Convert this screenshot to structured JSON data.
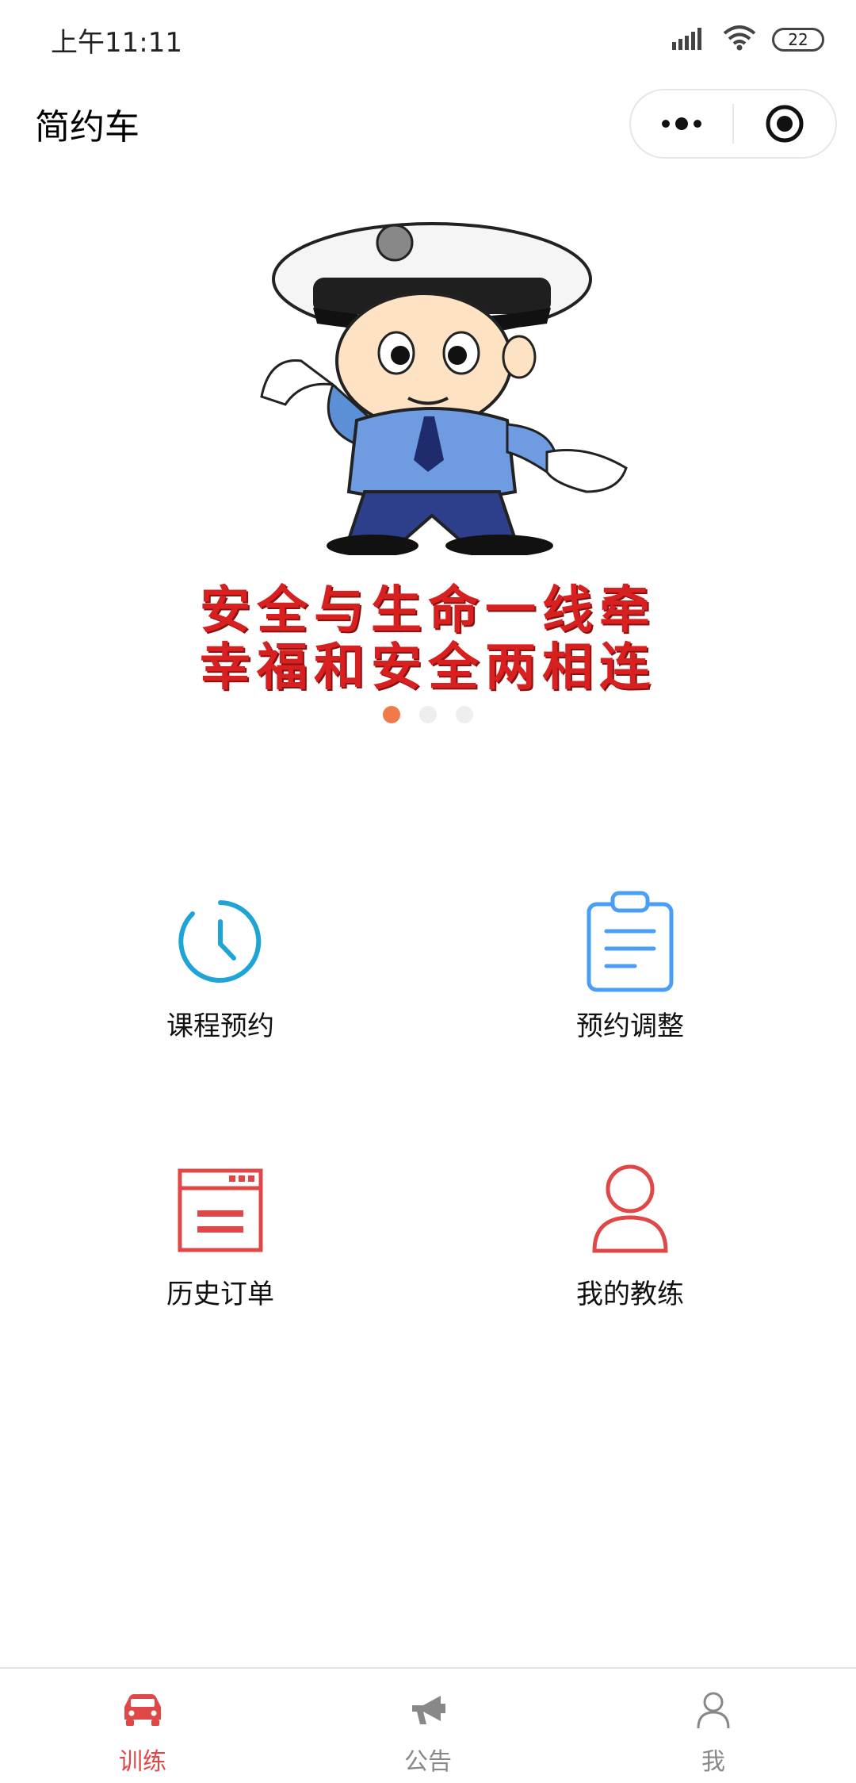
{
  "status": {
    "time": "上午11:11",
    "battery": "22"
  },
  "navbar": {
    "title": "简约车"
  },
  "banner": {
    "slogan_line1": "安全与生命一线牵",
    "slogan_line2": "幸福和安全两相连",
    "dots": 3,
    "active_dot": 0
  },
  "menu": {
    "course_booking": "课程预约",
    "booking_adjust": "预约调整",
    "order_history": "历史订单",
    "my_coach": "我的教练"
  },
  "tabs": {
    "training": "训练",
    "notice": "公告",
    "me": "我"
  },
  "colors": {
    "accent_red": "#e04848",
    "clock_blue": "#1fa4d8",
    "clipboard_blue": "#4a9ef5",
    "dot_orange": "#f07a4a"
  }
}
